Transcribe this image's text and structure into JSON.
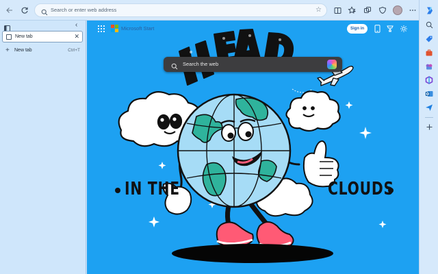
{
  "toolbar": {
    "address_placeholder": "Search or enter web address",
    "icons": [
      "back-icon",
      "refresh-icon",
      "search-icon",
      "favorite-star-icon",
      "split-screen-icon",
      "favorites-icon",
      "collections-icon",
      "performance-icon",
      "profile-avatar",
      "more-icon"
    ]
  },
  "tabs_panel": {
    "tabs": [
      {
        "label": "New tab",
        "active": true
      }
    ],
    "new_tab_label": "New tab",
    "new_tab_shortcut": "Ctrl+T"
  },
  "ms_start": {
    "brand": "Microsoft Start",
    "signin_label": "Sign in",
    "logo_colors": [
      "#f25022",
      "#7fba00",
      "#00a4ef",
      "#ffb900"
    ]
  },
  "search": {
    "placeholder": "Search the web"
  },
  "artwork": {
    "top_text": "HEAD",
    "left_text": "IN THE",
    "right_text": "CLOUDS",
    "background": "#1da1f2"
  },
  "sidebar": {
    "icons": [
      "copilot-icon",
      "search-icon",
      "shopping-icon",
      "tools-icon",
      "games-icon",
      "microsoft-365-icon",
      "outlook-icon",
      "send-icon",
      "add-icon"
    ]
  }
}
